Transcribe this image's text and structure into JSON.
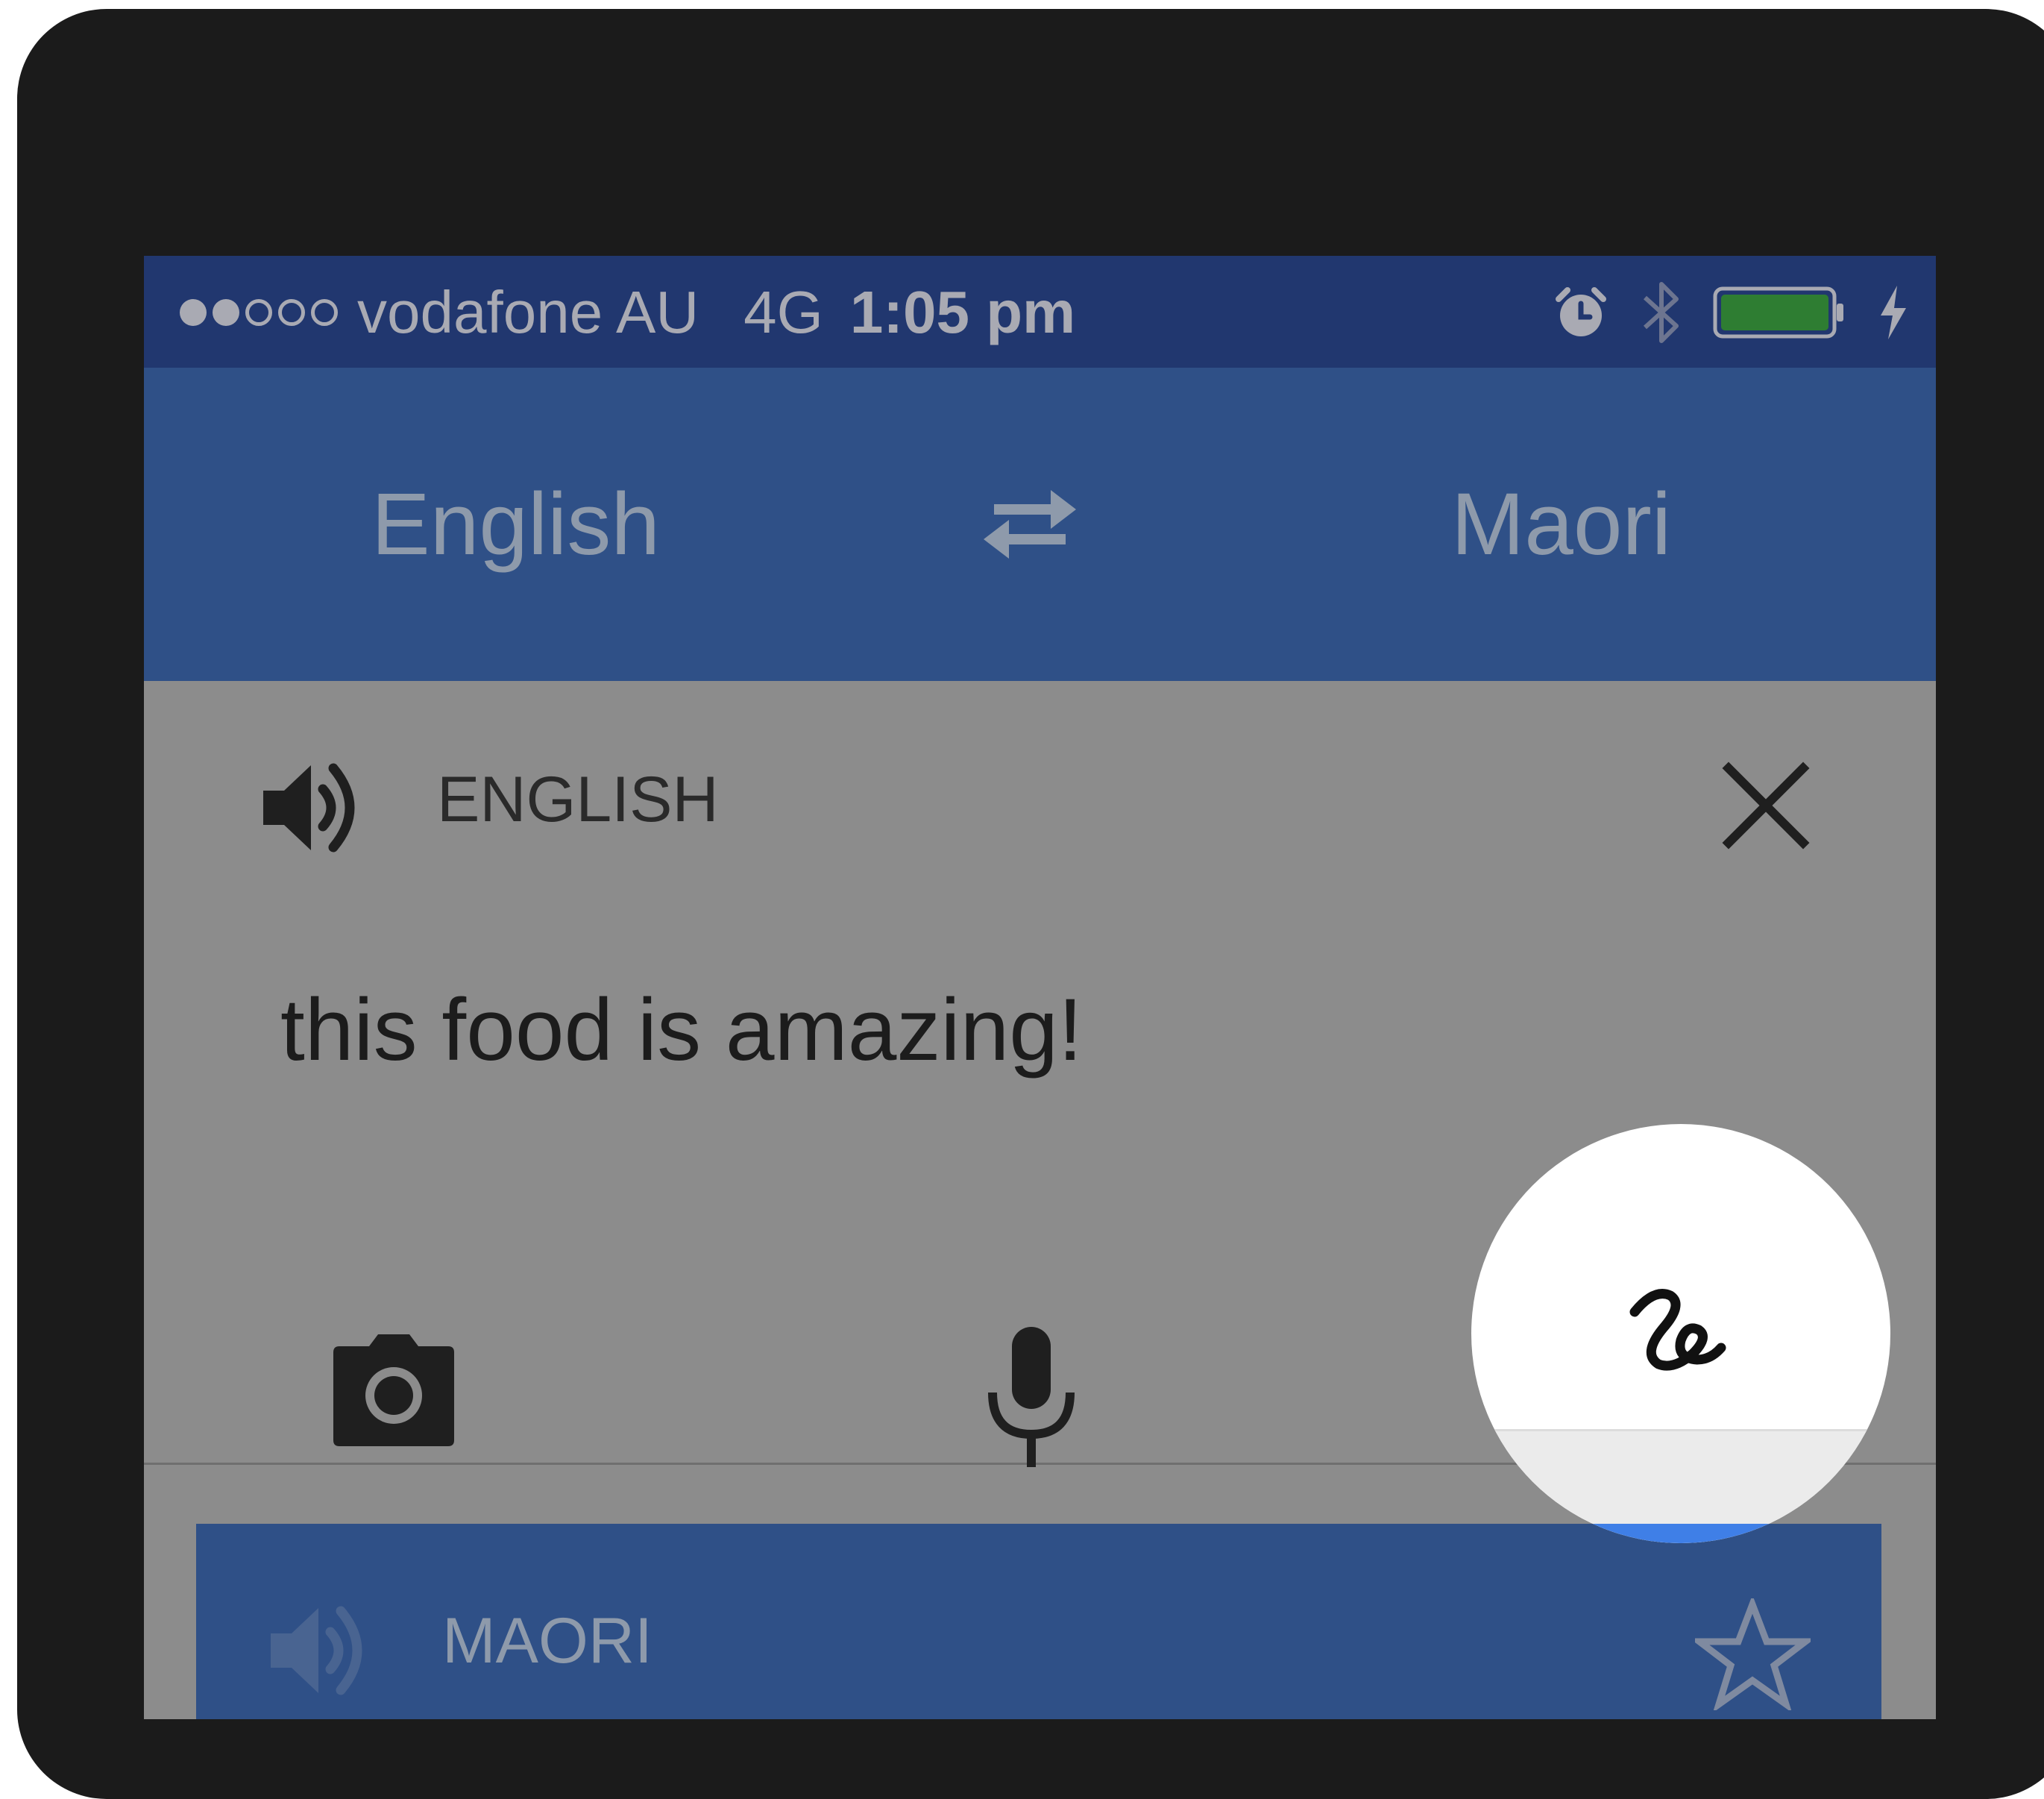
{
  "status_bar": {
    "signal_bars_filled": 2,
    "signal_bars_total": 5,
    "carrier": "vodafone AU",
    "network": "4G",
    "time": "1:05 pm",
    "icons": [
      "alarm-icon",
      "bluetooth-icon",
      "battery-icon",
      "charging-icon"
    ],
    "battery_level": 1.0,
    "battery_color": "#2e7d32"
  },
  "header": {
    "source_language": "English",
    "target_language": "Maori",
    "swap_icon": "swap-arrows-icon"
  },
  "input_card": {
    "language_label": "ENGLISH",
    "text": "this food is amazing!",
    "speaker_icon": "speaker-icon",
    "clear_icon": "close-icon",
    "tools": [
      "camera-icon",
      "microphone-icon",
      "handwriting-icon"
    ]
  },
  "result_card": {
    "language_label": "MAORI",
    "speaker_icon": "speaker-icon",
    "favorite_icon": "star-outline-icon"
  },
  "colors": {
    "status_bar_bg": "#21376f",
    "header_bg": "#2f5087",
    "overlay_bg": "#8c8c8c",
    "highlight_bg": "#ffffff",
    "accent_blue": "#3f7fe7"
  }
}
